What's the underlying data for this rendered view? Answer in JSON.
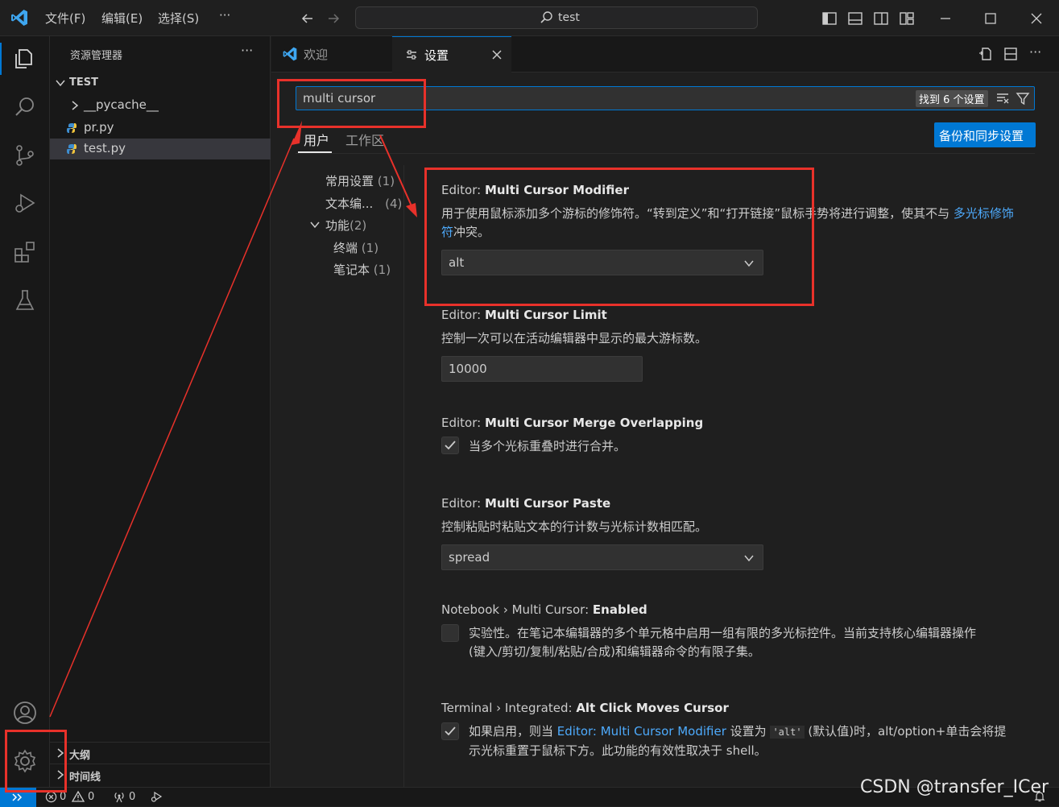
{
  "menu": {
    "file": "文件(F)",
    "edit": "编辑(E)",
    "selection": "选择(S)",
    "more": "···"
  },
  "command_center": {
    "text": "test"
  },
  "explorer": {
    "title": "资源管理器",
    "more": "···",
    "root": "TEST",
    "items": [
      {
        "label": "__pycache__",
        "type": "folder"
      },
      {
        "label": "pr.py",
        "type": "file"
      },
      {
        "label": "test.py",
        "type": "file",
        "selected": true
      }
    ],
    "outline": "大纲",
    "timeline": "时间线"
  },
  "tabs": [
    {
      "label": "欢迎",
      "active": false
    },
    {
      "label": "设置",
      "active": true
    }
  ],
  "settings": {
    "search_value": "multi cursor",
    "found_badge": "找到 6 个设置",
    "scope_tabs": [
      "用户",
      "工作区"
    ],
    "sync_button": "备份和同步设置",
    "toc": [
      {
        "label": "常用设置",
        "count": "(1)"
      },
      {
        "label": "文本编...",
        "count": "(4)"
      },
      {
        "label": "功能",
        "count": "(2)"
      },
      {
        "label": "终端",
        "count": "(1)"
      },
      {
        "label": "笔记本",
        "count": "(1)"
      }
    ],
    "items": [
      {
        "prefix": "Editor: ",
        "name": "Multi Cursor Modifier",
        "desc_pre": "用于使用鼠标添加多个游标的修饰符。“转到定义”和“打开链接”鼠标手势将进行调整，使其不与 ",
        "desc_link": "多光标修饰符",
        "desc_post": "冲突。",
        "value": "alt"
      },
      {
        "prefix": "Editor: ",
        "name": "Multi Cursor Limit",
        "desc": "控制一次可以在活动编辑器中显示的最大游标数。",
        "value": "10000"
      },
      {
        "prefix": "Editor: ",
        "name": "Multi Cursor Merge Overlapping",
        "desc": "当多个光标重叠时进行合并。",
        "checked": true
      },
      {
        "prefix": "Editor: ",
        "name": "Multi Cursor Paste",
        "desc": "控制粘贴时粘贴文本的行计数与光标计数相匹配。",
        "value": "spread"
      },
      {
        "prefix": "Notebook › Multi Cursor: ",
        "name": "Enabled",
        "desc_line1": "实验性。在笔记本编辑器的多个单元格中启用一组有限的多光标控件。当前支持核心编辑器操作",
        "desc_line2": "(键入/剪切/复制/粘贴/合成)和编辑器命令的有限子集。",
        "checked": false
      },
      {
        "prefix": "Terminal › Integrated: ",
        "name": "Alt Click Moves Cursor",
        "desc_pre": "如果启用，则当 ",
        "desc_link": "Editor: Multi Cursor Modifier",
        "desc_mid": " 设置为 ",
        "desc_code": "'alt'",
        "desc_post": " (默认值)时，alt/option+单击会将提",
        "desc_line2": "示光标重置于鼠标下方。此功能的有效性取决于 shell。",
        "checked": true
      }
    ]
  },
  "statusbar": {
    "errors": "0",
    "warnings": "0",
    "ports": "0"
  },
  "watermark": "CSDN @transfer_ICer",
  "colors": {
    "accent": "#0078d4",
    "annotation": "#e8312a",
    "link": "#4daafc"
  }
}
